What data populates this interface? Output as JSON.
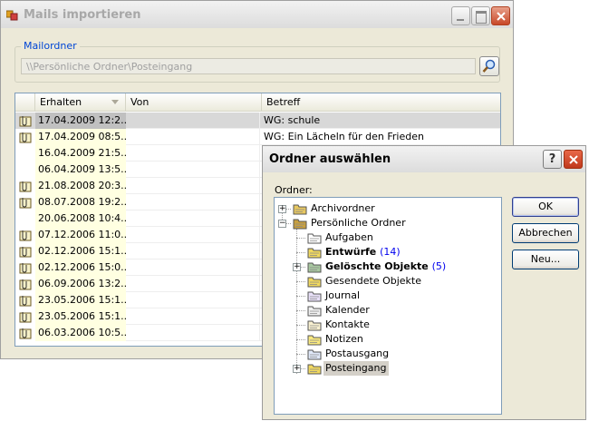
{
  "main_window": {
    "title": "Mails importieren",
    "mailordner_label": "Mailordner",
    "path_value": "\\\\Persönliche Ordner\\Posteingang",
    "columns": [
      "Erhalten",
      "Von",
      "Betreff"
    ],
    "rows": [
      {
        "date": "17.04.2009 12:2...",
        "from": "",
        "subject": "WG: schule",
        "attachment": true,
        "selected": true
      },
      {
        "date": "17.04.2009 08:5...",
        "from": "",
        "subject": "WG: Ein Lächeln für den Frieden",
        "attachment": true,
        "selected": false
      },
      {
        "date": "16.04.2009 21:5...",
        "from": "",
        "subject": "",
        "attachment": false,
        "selected": false
      },
      {
        "date": "06.04.2009 13:5...",
        "from": "",
        "subject": "",
        "attachment": false,
        "selected": false
      },
      {
        "date": "21.08.2008 20:3...",
        "from": "",
        "subject": "",
        "attachment": true,
        "selected": false
      },
      {
        "date": "08.07.2008 19:2...",
        "from": "",
        "subject": "",
        "attachment": true,
        "selected": false
      },
      {
        "date": "20.06.2008 10:4...",
        "from": "",
        "subject": "",
        "attachment": false,
        "selected": false
      },
      {
        "date": "07.12.2006 11:0...",
        "from": "",
        "subject": "",
        "attachment": true,
        "selected": false
      },
      {
        "date": "02.12.2006 15:1...",
        "from": "",
        "subject": "",
        "attachment": true,
        "selected": false
      },
      {
        "date": "02.12.2006 15:0...",
        "from": "",
        "subject": "",
        "attachment": true,
        "selected": false
      },
      {
        "date": "06.09.2006 13:2...",
        "from": "",
        "subject": "",
        "attachment": true,
        "selected": false
      },
      {
        "date": "23.05.2006 15:1...",
        "from": "",
        "subject": "",
        "attachment": true,
        "selected": false
      },
      {
        "date": "23.05.2006 15:1...",
        "from": "",
        "subject": "",
        "attachment": true,
        "selected": false
      },
      {
        "date": "06.03.2006 10:5...",
        "from": "",
        "subject": "",
        "attachment": true,
        "selected": false
      }
    ]
  },
  "dialog": {
    "title": "Ordner auswählen",
    "help_label": "?",
    "ordner_label": "Ordner:",
    "tree": [
      {
        "label": "Archivordner",
        "count": "",
        "level": 0,
        "expander": "+",
        "icon": "archive-folder-icon",
        "bold": false,
        "selected": false
      },
      {
        "label": "Persönliche Ordner",
        "count": "",
        "level": 0,
        "expander": "-",
        "icon": "personal-folders-icon",
        "bold": false,
        "selected": false
      },
      {
        "label": "Aufgaben",
        "count": "",
        "level": 1,
        "expander": "",
        "icon": "tasks-icon",
        "bold": false,
        "selected": false
      },
      {
        "label": "Entwürfe",
        "count": "(14)",
        "level": 1,
        "expander": "",
        "icon": "drafts-icon",
        "bold": true,
        "selected": false
      },
      {
        "label": "Gelöschte Objekte",
        "count": "(5)",
        "level": 1,
        "expander": "+",
        "icon": "deleted-items-icon",
        "bold": true,
        "selected": false
      },
      {
        "label": "Gesendete Objekte",
        "count": "",
        "level": 1,
        "expander": "",
        "icon": "sent-items-icon",
        "bold": false,
        "selected": false
      },
      {
        "label": "Journal",
        "count": "",
        "level": 1,
        "expander": "",
        "icon": "journal-icon",
        "bold": false,
        "selected": false
      },
      {
        "label": "Kalender",
        "count": "",
        "level": 1,
        "expander": "",
        "icon": "calendar-icon",
        "bold": false,
        "selected": false
      },
      {
        "label": "Kontakte",
        "count": "",
        "level": 1,
        "expander": "",
        "icon": "contacts-icon",
        "bold": false,
        "selected": false
      },
      {
        "label": "Notizen",
        "count": "",
        "level": 1,
        "expander": "",
        "icon": "notes-icon",
        "bold": false,
        "selected": false
      },
      {
        "label": "Postausgang",
        "count": "",
        "level": 1,
        "expander": "",
        "icon": "outbox-icon",
        "bold": false,
        "selected": false
      },
      {
        "label": "Posteingang",
        "count": "",
        "level": 1,
        "expander": "+",
        "icon": "inbox-icon",
        "bold": false,
        "selected": true
      }
    ],
    "buttons": {
      "ok": "OK",
      "cancel": "Abbrechen",
      "new": "Neu..."
    }
  },
  "colors": {
    "date_column_bg": "#ffffe1",
    "selected_row": "#d8d8d8",
    "group_label": "#0046d5",
    "count_blue": "#0000ee"
  }
}
